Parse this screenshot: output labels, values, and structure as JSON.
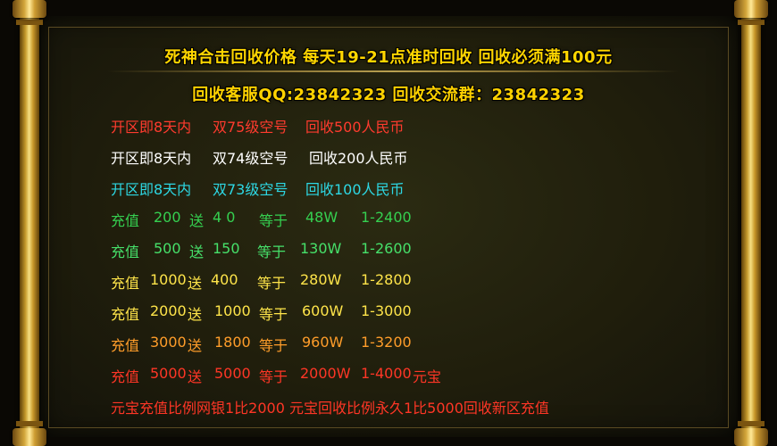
{
  "title_line_1": "死神合击回收价格 每天19-21点准时回收 回收必须满100元",
  "title_line_2": "回收客服QQ:23842323 回收交流群：23842323",
  "recycle_rows": [
    {
      "period": "开区即8天内",
      "item": "双75级空号",
      "price": "回收500人民币"
    },
    {
      "period": "开区即8天内",
      "item": "双74级空号",
      "price": "回收200人民币"
    },
    {
      "period": "开区即8天内",
      "item": "双73级空号",
      "price": "回收100人民币"
    }
  ],
  "recharge_rows": [
    {
      "label": "充值",
      "amount": "200",
      "bonus_label": "送",
      "bonus": "4 0",
      "equals": "等于",
      "value": "48W",
      "ratio": "1-2400",
      "suffix": ""
    },
    {
      "label": "充值",
      "amount": "500",
      "bonus_label": "送",
      "bonus": "150",
      "equals": "等于",
      "value": "130W",
      "ratio": "1-2600",
      "suffix": ""
    },
    {
      "label": "充值",
      "amount": "1000",
      "bonus_label": "送",
      "bonus": "400",
      "equals": "等于",
      "value": "280W",
      "ratio": "1-2800",
      "suffix": ""
    },
    {
      "label": "充值",
      "amount": "2000",
      "bonus_label": "送",
      "bonus": "1000",
      "equals": "等于",
      "value": "600W",
      "ratio": "1-3000",
      "suffix": ""
    },
    {
      "label": "充值",
      "amount": "3000",
      "bonus_label": "送",
      "bonus": "1800",
      "equals": "等于",
      "value": "960W",
      "ratio": "1-3200",
      "suffix": ""
    },
    {
      "label": "充值",
      "amount": "5000",
      "bonus_label": "送",
      "bonus": "5000",
      "equals": "等于",
      "value": "2000W",
      "ratio": "1-4000",
      "suffix": "元宝"
    }
  ],
  "footer_note": "元宝充值比例网银1比2000 元宝回收比例永久1比5000回收新区充值",
  "colors": {
    "title": "#ffd600",
    "recycle_row_1": "#ff3b2e",
    "recycle_row_2": "#ffffff",
    "recycle_row_3": "#2dd8e4",
    "recharge_row_1": "#35d050",
    "recharge_row_2": "#46e06a",
    "recharge_row_3": "#ffe54a",
    "recharge_row_4": "#ffe54a",
    "recharge_row_5": "#ff9d2a",
    "recharge_row_6": "#ff3626",
    "footer": "#ff3626"
  }
}
